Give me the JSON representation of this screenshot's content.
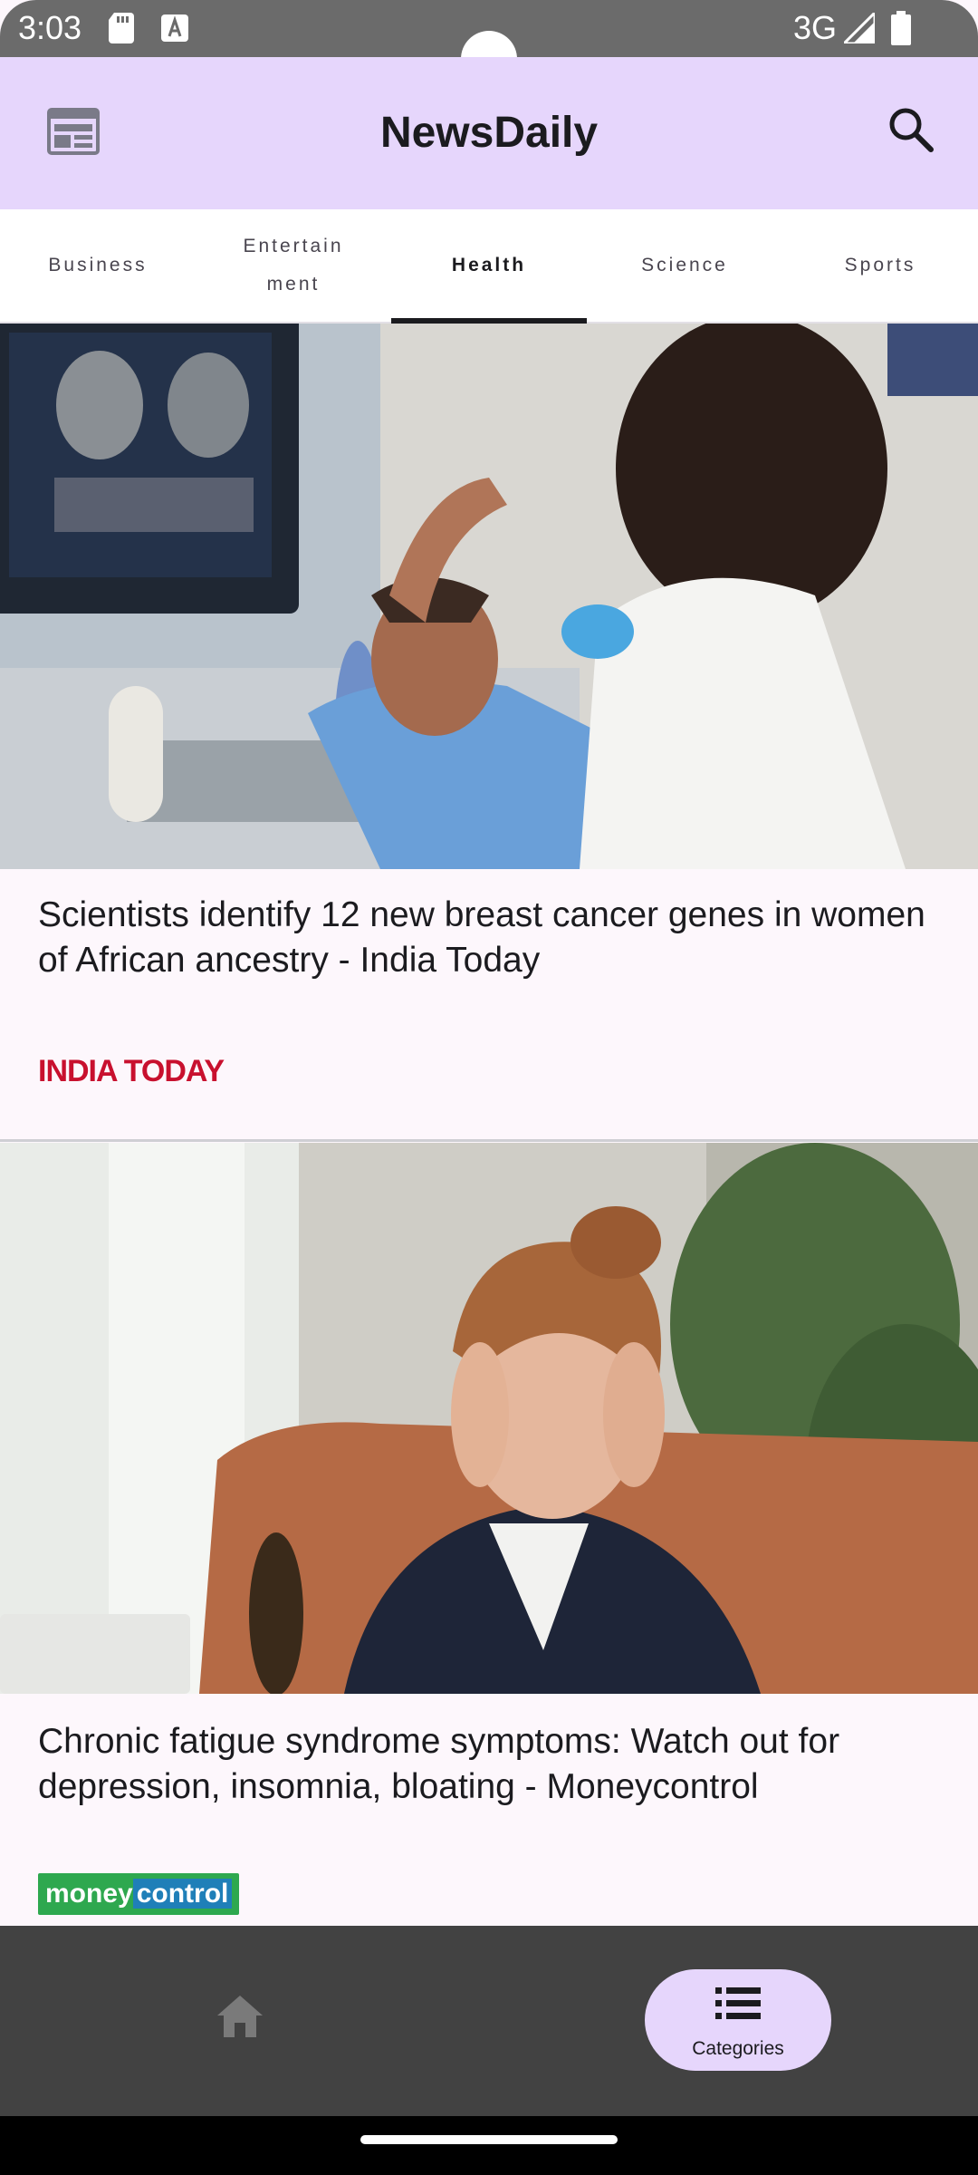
{
  "status_bar": {
    "time": "3:03",
    "network": "3G",
    "icons": [
      "sd-card-icon",
      "a-notification-icon",
      "signal-icon",
      "battery-icon"
    ]
  },
  "app_bar": {
    "title": "NewsDaily",
    "left_icon": "newspaper-icon",
    "right_icon": "search-icon",
    "background": "#e6d6fc"
  },
  "tabs": [
    {
      "label": "Business",
      "active": false
    },
    {
      "label": "Entertainment",
      "active": false
    },
    {
      "label": "Health",
      "active": true
    },
    {
      "label": "Science",
      "active": false
    },
    {
      "label": "Sports",
      "active": false
    }
  ],
  "articles": [
    {
      "headline": "Scientists identify 12 new breast cancer genes in women of African ancestry - India Today",
      "source_logo": "INDIA TODAY",
      "image": "ultrasound-exam-photo"
    },
    {
      "headline": "Chronic fatigue syndrome symptoms: Watch out for depression, insomnia, bloating - Moneycontrol",
      "source_logo": {
        "part1": "money",
        "part2": "control"
      },
      "image": "tired-woman-on-couch-photo"
    }
  ],
  "bottom_nav": {
    "items": [
      {
        "icon": "home-icon",
        "label": "",
        "active": false
      },
      {
        "icon": "list-icon",
        "label": "Categories",
        "active": true
      }
    ]
  },
  "colors": {
    "accent": "#e6d6fc",
    "india_today_red": "#c8102e",
    "moneycontrol_green": "#2ea84f",
    "moneycontrol_blue": "#1f7fb8"
  }
}
